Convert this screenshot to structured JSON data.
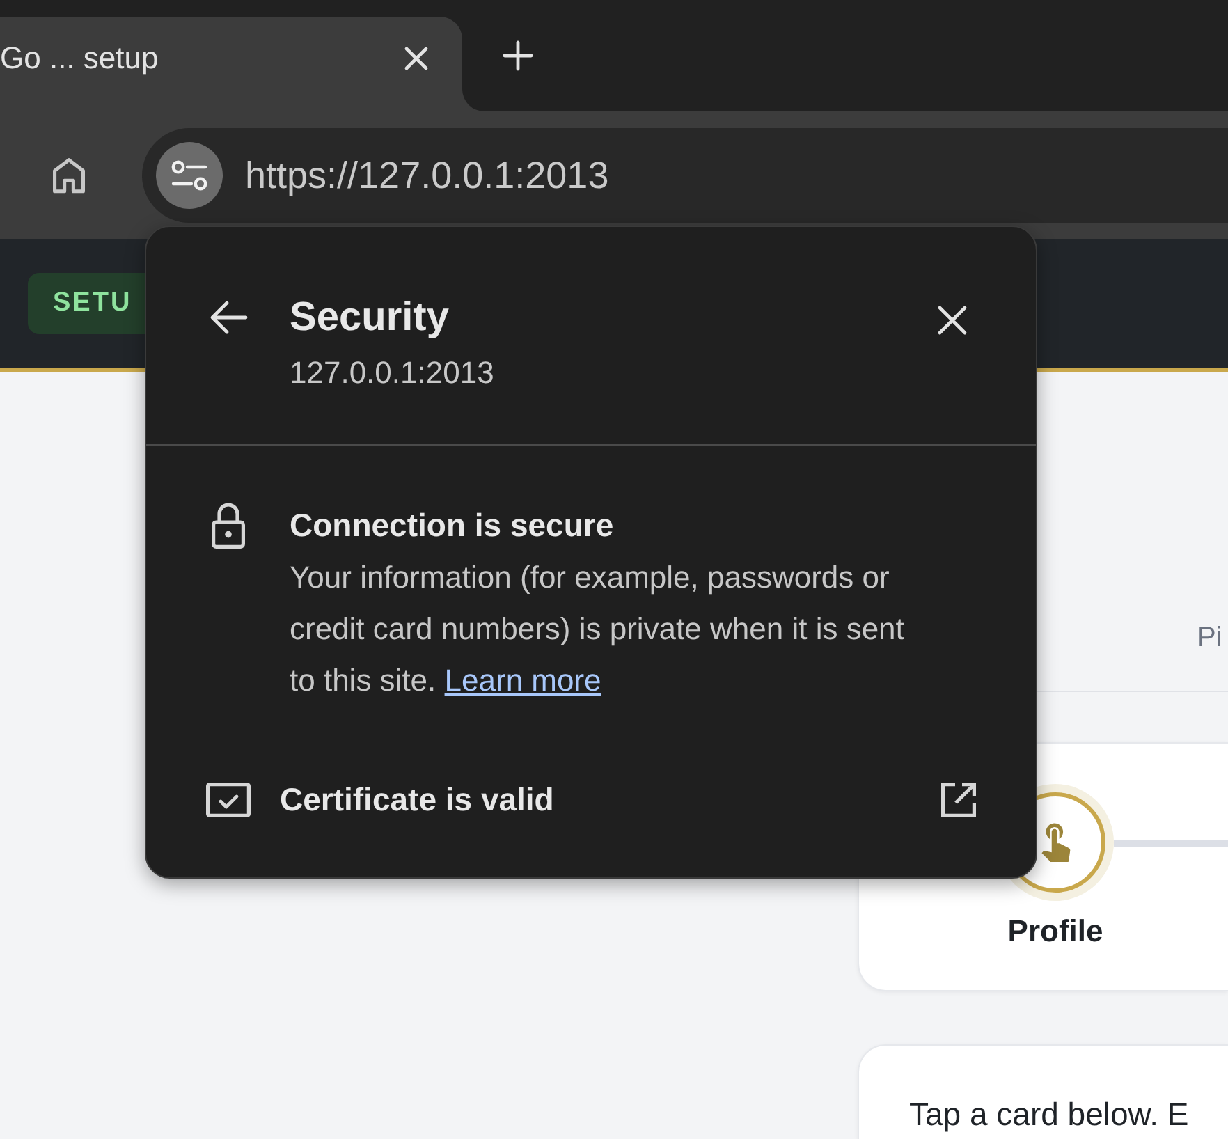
{
  "browser": {
    "tabs": [
      {
        "title": "Go ... setup",
        "selected": true
      }
    ],
    "address_bar": {
      "url": "https://127.0.0.1:2013"
    }
  },
  "app_header": {
    "badge": "SETU"
  },
  "page": {
    "partial_label": "Pi",
    "progress_steps": [
      {
        "label": "Profile",
        "active": true
      }
    ],
    "instructions": "Tap a card below. E"
  },
  "security_popup": {
    "title": "Security",
    "subtitle": "127.0.0.1:2013",
    "sections": [
      {
        "kind": "info",
        "heading": "Connection is secure",
        "text": "Your information (for example, passwords or credit card numbers) is private when it is sent to this site.",
        "link": "Learn more"
      },
      {
        "kind": "link_row",
        "label": "Certificate is valid"
      }
    ]
  }
}
